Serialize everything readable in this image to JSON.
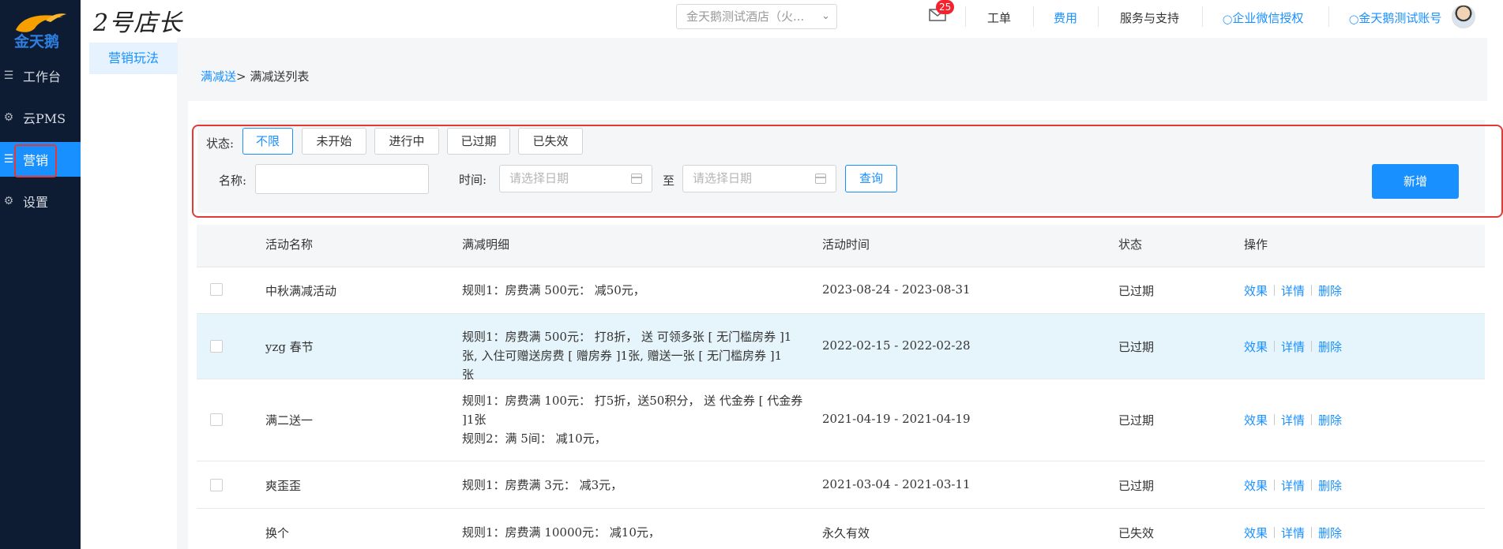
{
  "app": {
    "logo_text": "金天鹅",
    "brand": "2号店长"
  },
  "sidebar": {
    "items": [
      {
        "label": "工作台",
        "icon": "workbench-icon"
      },
      {
        "label": "云PMS",
        "icon": "gear-icon"
      },
      {
        "label": "营销",
        "icon": "marketing-icon",
        "active": true
      },
      {
        "label": "设置",
        "icon": "gear-icon"
      }
    ]
  },
  "topbar": {
    "hotel_select": "金天鹅测试酒店（火...",
    "mail_badge": "25",
    "links": {
      "workorder": "工单",
      "fee": "费用",
      "service": "服务与支持",
      "wechat_auth": "企业微信授权",
      "account": "金天鹅测试账号"
    }
  },
  "subnav": {
    "active": "营销玩法"
  },
  "breadcrumb": {
    "link": "满减送",
    "current": "> 满减送列表"
  },
  "filter": {
    "status_label": "状态:",
    "status_options": [
      "不限",
      "未开始",
      "进行中",
      "已过期",
      "已失效"
    ],
    "name_label": "名称:",
    "name_value": "",
    "time_label": "时间:",
    "date_from_placeholder": "请选择日期",
    "to_label": "至",
    "date_to_placeholder": "请选择日期",
    "query_button": "查询",
    "add_button": "新增"
  },
  "table": {
    "headers": [
      "活动名称",
      "满减明细",
      "活动时间",
      "状态",
      "操作"
    ],
    "op_labels": [
      "效果",
      "详情",
      "删除"
    ],
    "rows": [
      {
        "name": "中秋满减活动",
        "detail": [
          "规则1：房费满 500元： 减50元，"
        ],
        "time": "2023-08-24 - 2023-08-31",
        "status": "已过期",
        "checkbox": true
      },
      {
        "name": "yzg 春节",
        "detail": [
          "规则1：房费满 500元： 打8折， 送 可领多张 [ 无门槛房券 ]1张, 入住可赠送房费 [ 赠房券 ]1张, 赠送一张 [ 无门槛房券 ]1张"
        ],
        "time": "2022-02-15 - 2022-02-28",
        "status": "已过期",
        "checkbox": true
      },
      {
        "name": "满二送一",
        "detail": [
          "规则1：房费满 100元： 打5折，送50积分， 送 代金券 [ 代金券 ]1张",
          "规则2：满 5间： 减10元，"
        ],
        "time": "2021-04-19 - 2021-04-19",
        "status": "已过期",
        "checkbox": true
      },
      {
        "name": "爽歪歪",
        "detail": [
          "规则1：房费满 3元： 减3元，"
        ],
        "time": "2021-03-04 - 2021-03-11",
        "status": "已过期",
        "checkbox": true
      },
      {
        "name": "换个",
        "detail": [
          "规则1：房费满 10000元： 减10元，"
        ],
        "time": "永久有效",
        "status": "已失效",
        "checkbox": false
      }
    ]
  },
  "colors": {
    "primary": "#1890ff",
    "sidebar_bg": "#0e1c33",
    "highlight_red": "#e53935",
    "row_hover": "#e6f4fb"
  }
}
